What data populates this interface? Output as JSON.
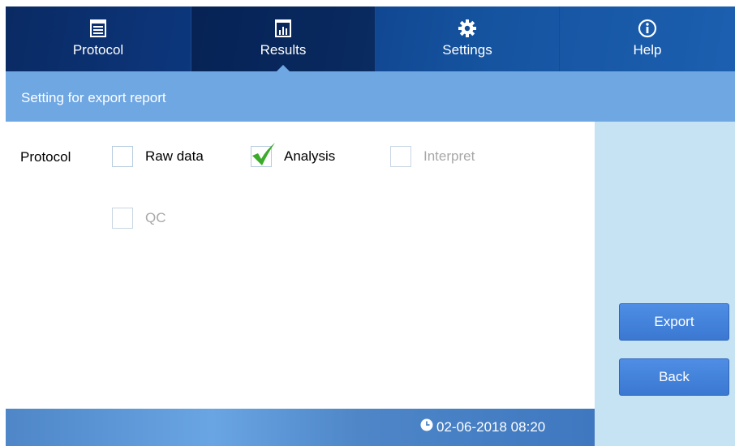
{
  "nav": {
    "tabs": [
      {
        "label": "Protocol",
        "icon": "document-icon",
        "active": false
      },
      {
        "label": "Results",
        "icon": "bar-chart-icon",
        "active": true
      },
      {
        "label": "Settings",
        "icon": "gear-icon",
        "active": false
      },
      {
        "label": "Help",
        "icon": "info-icon",
        "active": false
      }
    ]
  },
  "header": {
    "title": "Setting for export report"
  },
  "form": {
    "row_label": "Protocol",
    "options": [
      {
        "label": "Raw data",
        "checked": false,
        "enabled": true
      },
      {
        "label": "Analysis",
        "checked": true,
        "enabled": true
      },
      {
        "label": "Interpret",
        "checked": false,
        "enabled": false
      },
      {
        "label": "QC",
        "checked": false,
        "enabled": false
      }
    ]
  },
  "actions": {
    "export_label": "Export",
    "back_label": "Back"
  },
  "footer": {
    "datetime": "02-06-2018 08:20",
    "icon": "clock-icon"
  },
  "colors": {
    "nav_bg": "#0d3b85",
    "header_bg": "#6fa7e3",
    "sidebar_bg": "#c6e3f4",
    "button_bg": "#3f7fd8",
    "check_green": "#3cab2b"
  }
}
